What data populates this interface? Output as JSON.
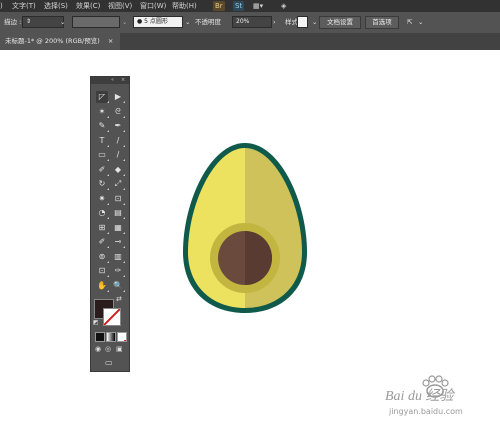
{
  "menu": {
    "items": [
      "文字(T)",
      "选择(S)",
      "效果(C)",
      "视图(V)",
      "窗口(W)",
      "帮助(H)"
    ],
    "app_icons": [
      "Br",
      "St"
    ]
  },
  "control_bar": {
    "stroke_label": "描边 :",
    "brush_value": "5 点圆形",
    "opacity_label": "不透明度",
    "opacity_value": "20%",
    "style_label": "样式 :",
    "doc_setup_button": "文档设置",
    "preferences_button": "首选项"
  },
  "document_tab": {
    "title": "未标题-1* @ 200% (RGB/预览)",
    "close": "×"
  },
  "toolbar": {
    "header_grip": "«",
    "header_menu": "×",
    "tools": [
      [
        "◸",
        "▶"
      ],
      [
        "✶",
        "ᘓ"
      ],
      [
        "✎",
        "✒"
      ],
      [
        "T",
        "/"
      ],
      [
        "▭",
        "/"
      ],
      [
        "✐",
        "◆"
      ],
      [
        "↻",
        "⤢"
      ],
      [
        "✷",
        "⊡"
      ],
      [
        "◔",
        "▤"
      ],
      [
        "⊞",
        "▦"
      ],
      [
        "✐",
        "⊸"
      ],
      [
        "⊚",
        "▥"
      ],
      [
        "⊡",
        "✑"
      ],
      [
        "✋",
        "🔍"
      ]
    ]
  },
  "colors": {
    "fill": "#2a1c1c",
    "stroke": "#ffffff",
    "avocado_outline": "#0f5a4a",
    "flesh_left": "#ece260",
    "flesh_right": "#cfc25a",
    "pit_ring": "#c2b540",
    "pit_left": "#6b4a3e",
    "pit_right": "#5a3b32"
  },
  "watermark": {
    "brand": "Bai du 经验",
    "url": "jingyan.baidu.com"
  }
}
